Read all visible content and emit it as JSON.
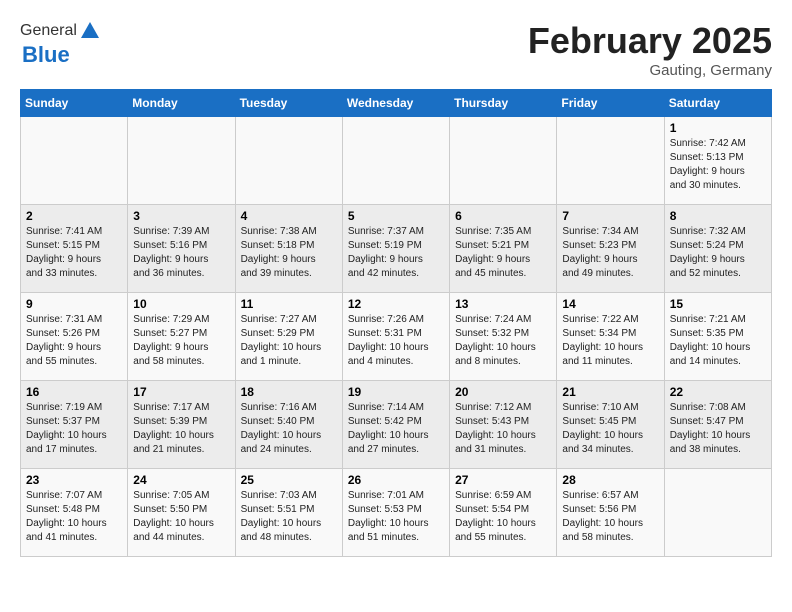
{
  "header": {
    "logo_general": "General",
    "logo_blue": "Blue",
    "month_title": "February 2025",
    "subtitle": "Gauting, Germany"
  },
  "days_of_week": [
    "Sunday",
    "Monday",
    "Tuesday",
    "Wednesday",
    "Thursday",
    "Friday",
    "Saturday"
  ],
  "weeks": [
    [
      {
        "day": "",
        "info": ""
      },
      {
        "day": "",
        "info": ""
      },
      {
        "day": "",
        "info": ""
      },
      {
        "day": "",
        "info": ""
      },
      {
        "day": "",
        "info": ""
      },
      {
        "day": "",
        "info": ""
      },
      {
        "day": "1",
        "info": "Sunrise: 7:42 AM\nSunset: 5:13 PM\nDaylight: 9 hours\nand 30 minutes."
      }
    ],
    [
      {
        "day": "2",
        "info": "Sunrise: 7:41 AM\nSunset: 5:15 PM\nDaylight: 9 hours\nand 33 minutes."
      },
      {
        "day": "3",
        "info": "Sunrise: 7:39 AM\nSunset: 5:16 PM\nDaylight: 9 hours\nand 36 minutes."
      },
      {
        "day": "4",
        "info": "Sunrise: 7:38 AM\nSunset: 5:18 PM\nDaylight: 9 hours\nand 39 minutes."
      },
      {
        "day": "5",
        "info": "Sunrise: 7:37 AM\nSunset: 5:19 PM\nDaylight: 9 hours\nand 42 minutes."
      },
      {
        "day": "6",
        "info": "Sunrise: 7:35 AM\nSunset: 5:21 PM\nDaylight: 9 hours\nand 45 minutes."
      },
      {
        "day": "7",
        "info": "Sunrise: 7:34 AM\nSunset: 5:23 PM\nDaylight: 9 hours\nand 49 minutes."
      },
      {
        "day": "8",
        "info": "Sunrise: 7:32 AM\nSunset: 5:24 PM\nDaylight: 9 hours\nand 52 minutes."
      }
    ],
    [
      {
        "day": "9",
        "info": "Sunrise: 7:31 AM\nSunset: 5:26 PM\nDaylight: 9 hours\nand 55 minutes."
      },
      {
        "day": "10",
        "info": "Sunrise: 7:29 AM\nSunset: 5:27 PM\nDaylight: 9 hours\nand 58 minutes."
      },
      {
        "day": "11",
        "info": "Sunrise: 7:27 AM\nSunset: 5:29 PM\nDaylight: 10 hours\nand 1 minute."
      },
      {
        "day": "12",
        "info": "Sunrise: 7:26 AM\nSunset: 5:31 PM\nDaylight: 10 hours\nand 4 minutes."
      },
      {
        "day": "13",
        "info": "Sunrise: 7:24 AM\nSunset: 5:32 PM\nDaylight: 10 hours\nand 8 minutes."
      },
      {
        "day": "14",
        "info": "Sunrise: 7:22 AM\nSunset: 5:34 PM\nDaylight: 10 hours\nand 11 minutes."
      },
      {
        "day": "15",
        "info": "Sunrise: 7:21 AM\nSunset: 5:35 PM\nDaylight: 10 hours\nand 14 minutes."
      }
    ],
    [
      {
        "day": "16",
        "info": "Sunrise: 7:19 AM\nSunset: 5:37 PM\nDaylight: 10 hours\nand 17 minutes."
      },
      {
        "day": "17",
        "info": "Sunrise: 7:17 AM\nSunset: 5:39 PM\nDaylight: 10 hours\nand 21 minutes."
      },
      {
        "day": "18",
        "info": "Sunrise: 7:16 AM\nSunset: 5:40 PM\nDaylight: 10 hours\nand 24 minutes."
      },
      {
        "day": "19",
        "info": "Sunrise: 7:14 AM\nSunset: 5:42 PM\nDaylight: 10 hours\nand 27 minutes."
      },
      {
        "day": "20",
        "info": "Sunrise: 7:12 AM\nSunset: 5:43 PM\nDaylight: 10 hours\nand 31 minutes."
      },
      {
        "day": "21",
        "info": "Sunrise: 7:10 AM\nSunset: 5:45 PM\nDaylight: 10 hours\nand 34 minutes."
      },
      {
        "day": "22",
        "info": "Sunrise: 7:08 AM\nSunset: 5:47 PM\nDaylight: 10 hours\nand 38 minutes."
      }
    ],
    [
      {
        "day": "23",
        "info": "Sunrise: 7:07 AM\nSunset: 5:48 PM\nDaylight: 10 hours\nand 41 minutes."
      },
      {
        "day": "24",
        "info": "Sunrise: 7:05 AM\nSunset: 5:50 PM\nDaylight: 10 hours\nand 44 minutes."
      },
      {
        "day": "25",
        "info": "Sunrise: 7:03 AM\nSunset: 5:51 PM\nDaylight: 10 hours\nand 48 minutes."
      },
      {
        "day": "26",
        "info": "Sunrise: 7:01 AM\nSunset: 5:53 PM\nDaylight: 10 hours\nand 51 minutes."
      },
      {
        "day": "27",
        "info": "Sunrise: 6:59 AM\nSunset: 5:54 PM\nDaylight: 10 hours\nand 55 minutes."
      },
      {
        "day": "28",
        "info": "Sunrise: 6:57 AM\nSunset: 5:56 PM\nDaylight: 10 hours\nand 58 minutes."
      },
      {
        "day": "",
        "info": ""
      }
    ]
  ]
}
